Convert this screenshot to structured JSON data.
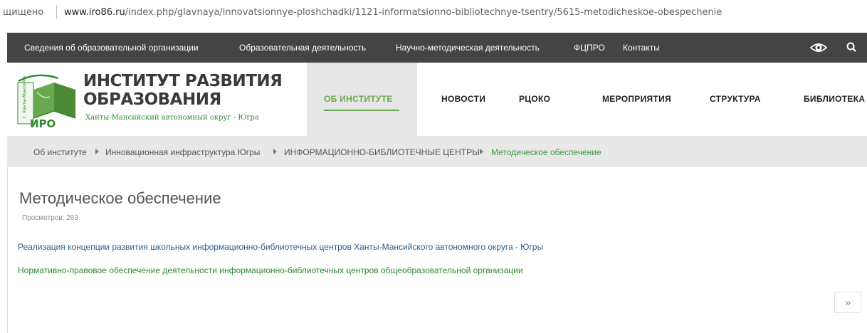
{
  "browser": {
    "status_text": "щищено",
    "url_host": "www.iro86.ru",
    "url_path": "/index.php/glavnaya/innovatsionnye-ploshchadki/1121-informatsionno-bibliotechnye-tsentry/5615-metodicheskoe-obespechenie"
  },
  "topnav": {
    "items": [
      "Сведения об образовательной организации",
      "Образовательная деятельность",
      "Научно-методическая деятельность",
      "ФЦПРО",
      "Контакты"
    ],
    "icons": [
      "eye-icon",
      "search-icon"
    ]
  },
  "brand": {
    "line1": "ИНСТИТУТ РАЗВИТИЯ",
    "line2": "ОБРАЗОВАНИЯ",
    "subtitle": "Ханты-Мансийский автономный округ - Югра",
    "logo_text": "ИРО",
    "logo_side_text": "г. Ханты-Мансийск"
  },
  "mainnav": {
    "items": [
      "ОБ ИНСТИТУТЕ",
      "НОВОСТИ",
      "РЦОКО",
      "МЕРОПРИЯТИЯ",
      "СТРУКТУРА",
      "БИБЛИОТЕКА"
    ],
    "active_index": 0
  },
  "breadcrumb": [
    "Об институте",
    "Инновационная инфраструктура Югры",
    "ИНФОРМАЦИОННО-БИБЛИОТЕЧНЫЕ ЦЕНТРЫ",
    "Методическое обеспечение"
  ],
  "article": {
    "title": "Методическое обеспечение",
    "views": "Просмотров: 263",
    "links": [
      "Реализация концепции развития школьных информационно-библиотечных центров Ханты-Мансийского автономного округа - Югры",
      "Нормативно-правовое обеспечение деятельности информационно-библиотечных центров общеобразовательной организации"
    ]
  },
  "pagination": {
    "next_label": "»"
  },
  "colors": {
    "topnav_bg": "#444444",
    "accent_green": "#6aa84f",
    "link_blue": "#2f5b8a",
    "link_green": "#2e8b2e",
    "breadcrumb_bg": "#e8e8e8"
  }
}
